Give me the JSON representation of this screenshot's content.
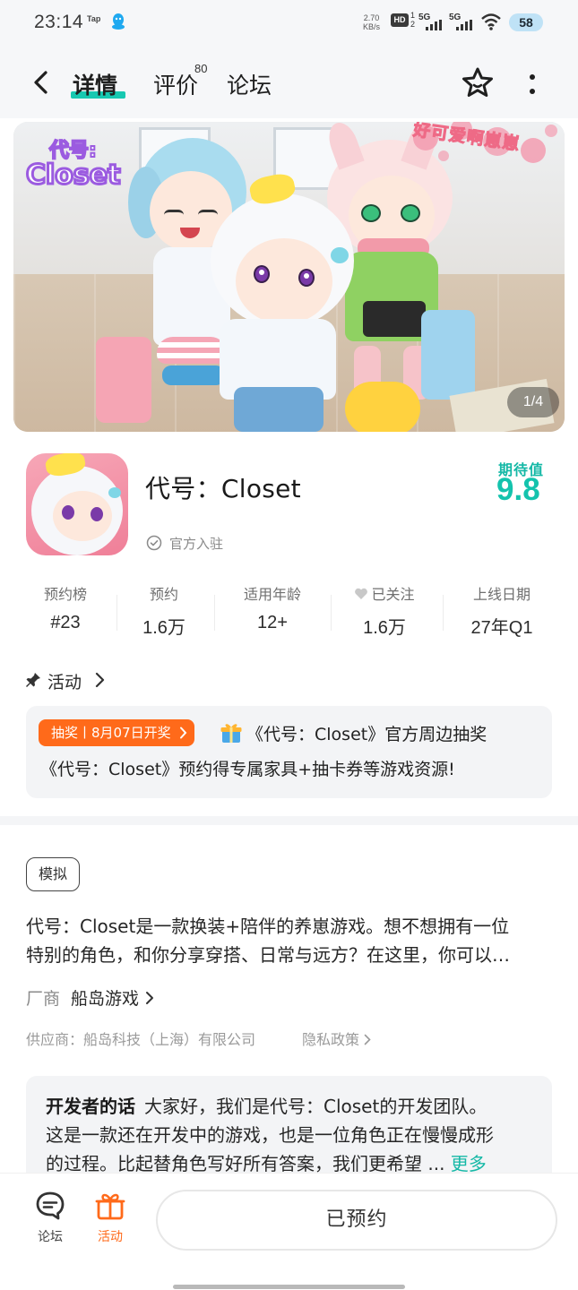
{
  "status_bar": {
    "time": "23:14",
    "tap_label": "Tap",
    "net_speed_value": "2.70",
    "net_speed_unit": "KB/s",
    "hd_label": "HD",
    "hd_sub_top": "1",
    "hd_sub_bottom": "2",
    "signal_1_label": "5G",
    "signal_2_label": "5G",
    "battery_level": "58"
  },
  "header": {
    "tabs": [
      {
        "label": "详情",
        "active": true
      },
      {
        "label": "评价",
        "badge": "80"
      },
      {
        "label": "论坛"
      }
    ]
  },
  "hero": {
    "logo_line1": "代号:",
    "logo_line2": "Closet",
    "sticker_text": "好可爱啊崽崽",
    "counter": "1/4"
  },
  "game": {
    "title": "代号：Closet",
    "official_label": "官方入驻",
    "expect_label": "期待值",
    "expect_score": "9.8"
  },
  "stats": [
    {
      "label": "预约榜",
      "value": "#23"
    },
    {
      "label": "预约",
      "value": "1.6万"
    },
    {
      "label": "适用年龄",
      "value": "12+"
    },
    {
      "label": "已关注",
      "value": "1.6万",
      "icon": "heart-icon"
    },
    {
      "label": "上线日期",
      "value": "27年Q1"
    }
  ],
  "activity": {
    "title": "活动",
    "tag": "抽奖丨8月07日开奖",
    "line1": "《代号：Closet》官方周边抽奖",
    "line2": "《代号：Closet》预约得专属家具+抽卡券等游戏资源!"
  },
  "description": {
    "genre_tag": "模拟",
    "line1": "代号：Closet是一款换装+陪伴的养崽游戏。想不想拥有一位",
    "line2": "特别的角色，和你分享穿搭、日常与远方？在这里，你可以…",
    "vendor_label": "厂商",
    "vendor_name": "船岛游戏",
    "supplier": "供应商：船岛科技（上海）有限公司",
    "privacy": "隐私政策"
  },
  "developer": {
    "label": "开发者的话",
    "line1": "大家好，我们是代号：Closet的开发团队。",
    "line2": "这是一款还在开发中的游戏，也是一位角色正在慢慢成形",
    "line3": "的过程。比起替角色写好所有答案，我们更希望 ...",
    "more": "更多"
  },
  "bottom_bar": {
    "forum_label": "论坛",
    "activity_label": "活动",
    "reserve_button": "已预约"
  },
  "colors": {
    "accent_teal": "#14c3ad",
    "accent_orange": "#ff6a1a",
    "page_bg": "#f6f7f9"
  }
}
